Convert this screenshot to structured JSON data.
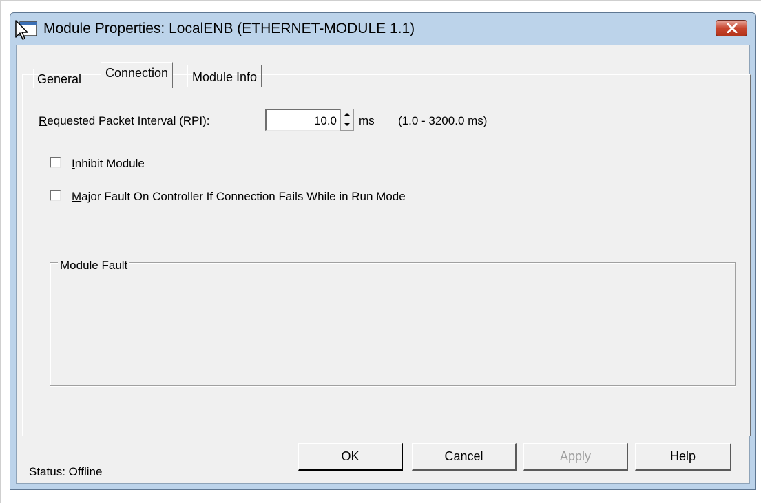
{
  "window": {
    "title": "Module Properties: LocalENB (ETHERNET-MODULE 1.1)"
  },
  "tabs": [
    {
      "label": "General",
      "active": false
    },
    {
      "label": "Connection",
      "active": true
    },
    {
      "label": "Module Info",
      "active": false
    }
  ],
  "rpi": {
    "label_mnemonic": "R",
    "label_rest": "equested Packet Interval (RPI):",
    "value": "10.0",
    "unit": "ms",
    "range": "(1.0 - 3200.0 ms)"
  },
  "inhibit_module": {
    "mnemonic": "I",
    "rest": "nhibit Module",
    "checked": false
  },
  "major_fault": {
    "mnemonic": "M",
    "rest": "ajor Fault On Controller If Connection Fails While in Run Mode",
    "checked": false
  },
  "module_fault": {
    "title": "Module Fault"
  },
  "status": {
    "text": "Status:  Offline"
  },
  "buttons": {
    "ok": "OK",
    "cancel": "Cancel",
    "apply": "Apply",
    "help": "Help"
  },
  "colors": {
    "window_frame": "#bcd3ea",
    "dialog_face": "#f0f0f0",
    "close_button": "#c8462f",
    "disabled_text": "#a0a0a0"
  },
  "icons": [
    "module-properties-app-icon",
    "close-icon",
    "spin-up-icon",
    "spin-down-icon"
  ]
}
